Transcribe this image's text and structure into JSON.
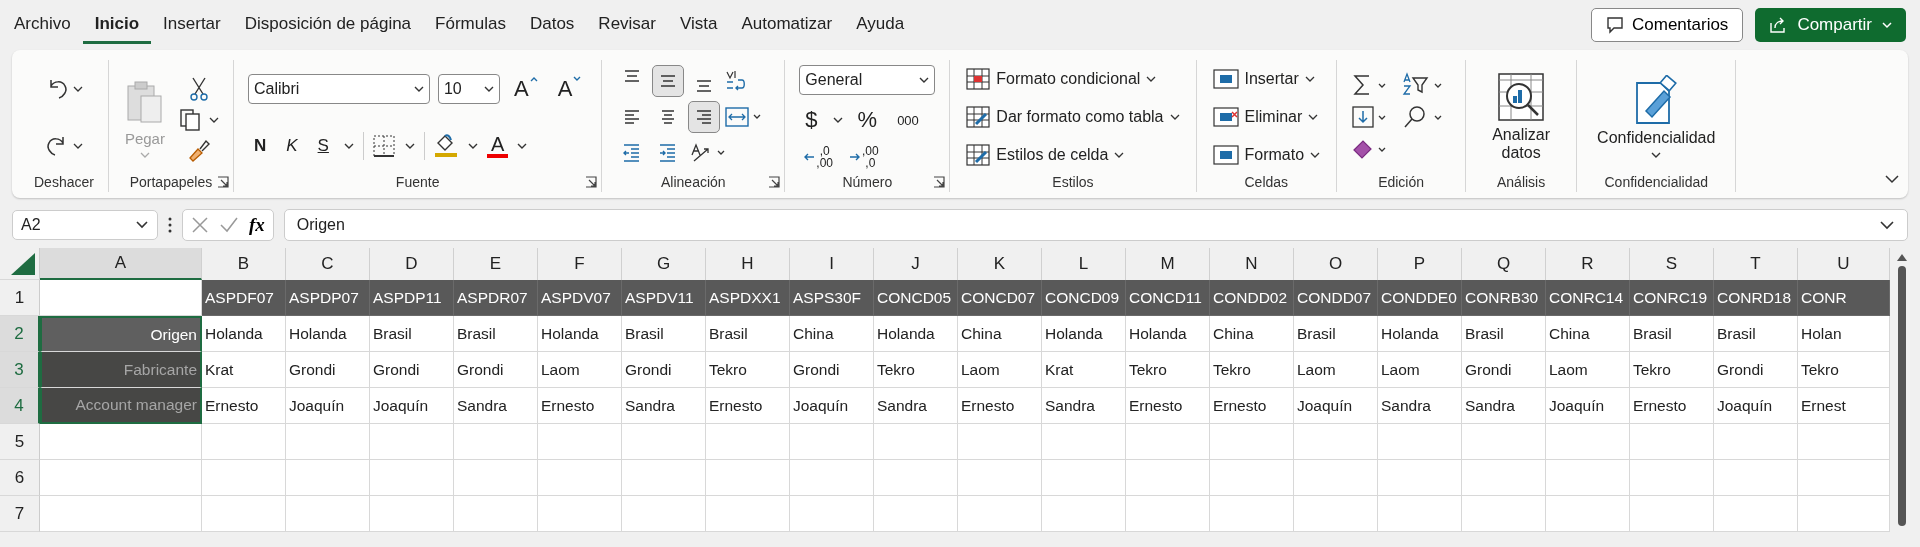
{
  "menu_tabs": [
    {
      "label": "Archivo",
      "selected": false
    },
    {
      "label": "Inicio",
      "selected": true
    },
    {
      "label": "Insertar",
      "selected": false
    },
    {
      "label": "Disposición de página",
      "selected": false
    },
    {
      "label": "Fórmulas",
      "selected": false
    },
    {
      "label": "Datos",
      "selected": false
    },
    {
      "label": "Revisar",
      "selected": false
    },
    {
      "label": "Vista",
      "selected": false
    },
    {
      "label": "Automatizar",
      "selected": false
    },
    {
      "label": "Ayuda",
      "selected": false
    }
  ],
  "comments_button": "Comentarios",
  "share_button": "Compartir",
  "ribbon": {
    "undo": {
      "label": "Deshacer"
    },
    "clipboard": {
      "paste": "Pegar",
      "label": "Portapapeles"
    },
    "font": {
      "name": "Calibri",
      "size": "10",
      "grow": "A",
      "shrink": "A",
      "bold": "N",
      "italic": "K",
      "underline": "S",
      "font_color_letter": "A",
      "label": "Fuente"
    },
    "alignment": {
      "buttons": [
        {
          "selected": false
        },
        {
          "selected": true
        },
        {
          "selected": false
        },
        {
          "selected": false
        },
        {
          "selected": false
        },
        {
          "selected": true
        },
        {
          "selected": false
        },
        {
          "selected": false
        }
      ],
      "label": "Alineación"
    },
    "number": {
      "format": "General",
      "currency": "$",
      "percent": "%",
      "thousands": "000",
      "increase_decimals": [
        ",0",
        ",00"
      ],
      "decrease_decimals": [
        ",00",
        ",0"
      ],
      "label": "Número"
    },
    "styles": {
      "items": [
        "Formato condicional",
        "Dar formato como tabla",
        "Estilos de celda"
      ],
      "label": "Estilos"
    },
    "cells": {
      "items": [
        "Insertar",
        "Eliminar",
        "Formato"
      ],
      "label": "Celdas"
    },
    "editing": {
      "label": "Edición"
    },
    "analysis": {
      "button": "Analizar datos",
      "label": "Análisis"
    },
    "sensitivity": {
      "button": "Confidencialidad",
      "label": "Confidencialidad"
    }
  },
  "formula_bar": {
    "name_box": "A2",
    "fx": "fx",
    "value": "Origen"
  },
  "sheet": {
    "columns": [
      {
        "label": "A",
        "selected": true
      },
      {
        "label": "B",
        "selected": false
      },
      {
        "label": "C",
        "selected": false
      },
      {
        "label": "D",
        "selected": false
      },
      {
        "label": "E",
        "selected": false
      },
      {
        "label": "F",
        "selected": false
      },
      {
        "label": "G",
        "selected": false
      },
      {
        "label": "H",
        "selected": false
      },
      {
        "label": "I",
        "selected": false
      },
      {
        "label": "J",
        "selected": false
      },
      {
        "label": "K",
        "selected": false
      },
      {
        "label": "L",
        "selected": false
      },
      {
        "label": "M",
        "selected": false
      },
      {
        "label": "N",
        "selected": false
      },
      {
        "label": "O",
        "selected": false
      },
      {
        "label": "P",
        "selected": false
      },
      {
        "label": "Q",
        "selected": false
      },
      {
        "label": "R",
        "selected": false
      },
      {
        "label": "S",
        "selected": false
      },
      {
        "label": "T",
        "selected": false
      },
      {
        "label": "U",
        "selected": false
      }
    ],
    "header_row": {
      "header": "1",
      "selected": false,
      "cells": [
        "ASPDF07",
        "ASPDP07",
        "ASPDP11",
        "ASPDR07",
        "ASPDV07",
        "ASPDV11",
        "ASPDXX1",
        "ASPS30F",
        "CONCD05",
        "CONCD07",
        "CONCD09",
        "CONCD11",
        "CONDD02",
        "CONDD07",
        "CONDDE0",
        "CONRB30",
        "CONRC14",
        "CONRC19",
        "CONRD18",
        "CONR"
      ]
    },
    "data_rows": [
      {
        "header": "2",
        "selected": true,
        "active": true,
        "label": "Origen",
        "cells": [
          "Holanda",
          "Holanda",
          "Brasil",
          "Brasil",
          "Holanda",
          "Brasil",
          "Brasil",
          "China",
          "Holanda",
          "China",
          "Holanda",
          "Holanda",
          "China",
          "Brasil",
          "Holanda",
          "Brasil",
          "China",
          "Brasil",
          "Brasil",
          "Holan"
        ]
      },
      {
        "header": "3",
        "selected": true,
        "active": false,
        "label": "Fabricante",
        "cells": [
          "Krat",
          "Grondi",
          "Grondi",
          "Grondi",
          "Laom",
          "Grondi",
          "Tekro",
          "Grondi",
          "Tekro",
          "Laom",
          "Krat",
          "Tekro",
          "Tekro",
          "Laom",
          "Laom",
          "Grondi",
          "Laom",
          "Tekro",
          "Grondi",
          "Tekro"
        ]
      },
      {
        "header": "4",
        "selected": true,
        "active": false,
        "label": "Account manager",
        "cells": [
          "Ernesto",
          "Joaquín",
          "Joaquín",
          "Sandra",
          "Ernesto",
          "Sandra",
          "Ernesto",
          "Joaquín",
          "Sandra",
          "Ernesto",
          "Sandra",
          "Ernesto",
          "Ernesto",
          "Joaquín",
          "Sandra",
          "Sandra",
          "Joaquín",
          "Ernesto",
          "Joaquín",
          "Ernest"
        ]
      }
    ],
    "empty_rows": [
      {
        "header": "5",
        "selected": false
      },
      {
        "header": "6",
        "selected": false
      },
      {
        "header": "7",
        "selected": false
      }
    ]
  }
}
